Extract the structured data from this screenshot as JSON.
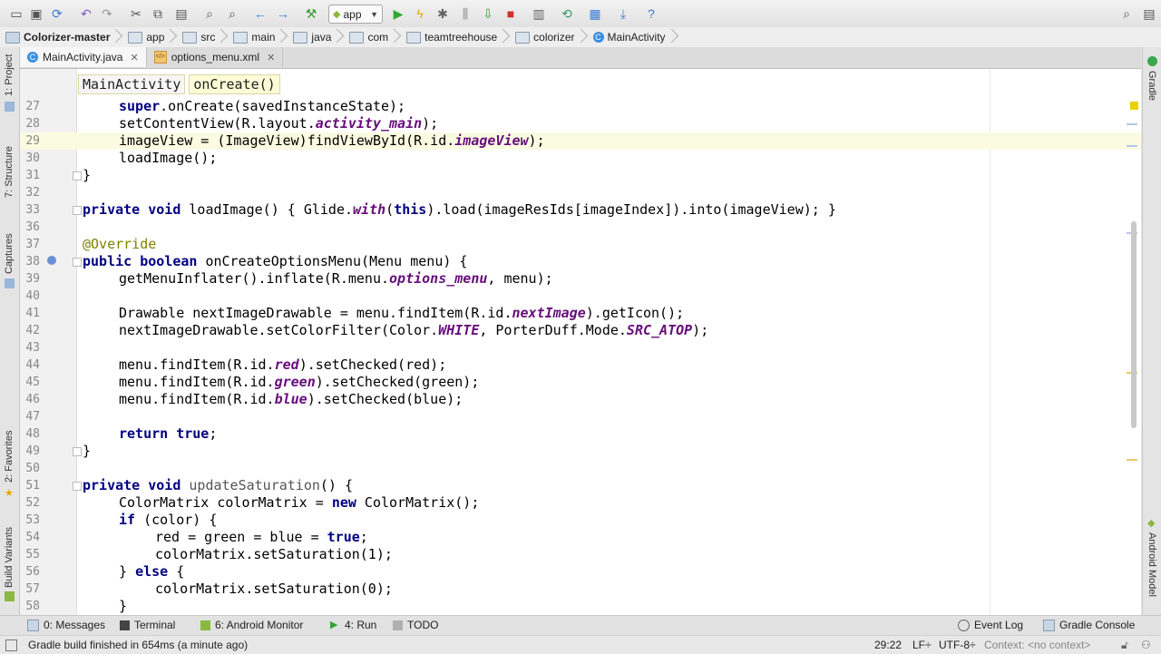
{
  "toolbar": {
    "run_config": "app",
    "icons": [
      "open-icon",
      "save-icon",
      "sync-icon",
      "undo-icon",
      "redo-icon",
      "cut-icon",
      "copy-icon",
      "paste-icon",
      "find-icon",
      "replace-icon",
      "back-icon",
      "forward-icon",
      "make-icon",
      "run-icon",
      "apply-changes-icon",
      "debug-icon",
      "attach-icon",
      "profile-icon",
      "stop-icon",
      "avd-manager-icon",
      "gradle-sync-icon",
      "project-structure-icon",
      "sdk-manager-icon",
      "help-icon",
      "search-icon"
    ]
  },
  "breadcrumb": [
    "Colorizer-master",
    "app",
    "src",
    "main",
    "java",
    "com",
    "teamtreehouse",
    "colorizer",
    "MainActivity"
  ],
  "tabs": [
    {
      "label": "MainActivity.java",
      "active": true
    },
    {
      "label": "options_menu.xml",
      "active": false
    }
  ],
  "method_crumbs": [
    "MainActivity",
    "onCreate()"
  ],
  "left_tools": [
    "1: Project",
    "7: Structure",
    "Captures",
    "2: Favorites",
    "Build Variants"
  ],
  "right_tools": [
    "Gradle",
    "Android Model"
  ],
  "code_lines": [
    {
      "n": "27",
      "t": "super.onCreate(savedInstanceState);"
    },
    {
      "n": "28",
      "t": "setContentView(R.layout.activity_main);"
    },
    {
      "n": "29",
      "t": "imageView = (ImageView)findViewById(R.id.imageView);"
    },
    {
      "n": "30",
      "t": "loadImage();"
    },
    {
      "n": "31",
      "t": "}"
    },
    {
      "n": "32",
      "t": ""
    },
    {
      "n": "33",
      "t": "private void loadImage() { Glide.with(this).load(imageResIds[imageIndex]).into(imageView); }"
    },
    {
      "n": "36",
      "t": ""
    },
    {
      "n": "37",
      "t": "@Override"
    },
    {
      "n": "38",
      "t": "public boolean onCreateOptionsMenu(Menu menu) {"
    },
    {
      "n": "39",
      "t": "getMenuInflater().inflate(R.menu.options_menu, menu);"
    },
    {
      "n": "40",
      "t": ""
    },
    {
      "n": "41",
      "t": "Drawable nextImageDrawable = menu.findItem(R.id.nextImage).getIcon();"
    },
    {
      "n": "42",
      "t": "nextImageDrawable.setColorFilter(Color.WHITE, PorterDuff.Mode.SRC_ATOP);"
    },
    {
      "n": "43",
      "t": ""
    },
    {
      "n": "44",
      "t": "menu.findItem(R.id.red).setChecked(red);"
    },
    {
      "n": "45",
      "t": "menu.findItem(R.id.green).setChecked(green);"
    },
    {
      "n": "46",
      "t": "menu.findItem(R.id.blue).setChecked(blue);"
    },
    {
      "n": "47",
      "t": ""
    },
    {
      "n": "48",
      "t": "return true;"
    },
    {
      "n": "49",
      "t": "}"
    },
    {
      "n": "50",
      "t": ""
    },
    {
      "n": "51",
      "t": "private void updateSaturation() {"
    },
    {
      "n": "52",
      "t": "ColorMatrix colorMatrix = new ColorMatrix();"
    },
    {
      "n": "53",
      "t": "if (color) {"
    },
    {
      "n": "54",
      "t": "red = green = blue = true;"
    },
    {
      "n": "55",
      "t": "colorMatrix.setSaturation(1);"
    },
    {
      "n": "56",
      "t": "} else {"
    },
    {
      "n": "57",
      "t": "colorMatrix.setSaturation(0);"
    },
    {
      "n": "58",
      "t": "}"
    }
  ],
  "bottom_tools": {
    "messages": "0: Messages",
    "terminal": "Terminal",
    "android_monitor": "6: Android Monitor",
    "run": "4: Run",
    "todo": "TODO",
    "event_log": "Event Log",
    "gradle_console": "Gradle Console"
  },
  "status": {
    "message": "Gradle build finished in 654ms (a minute ago)",
    "position": "29:22",
    "line_sep": "LF÷",
    "encoding": "UTF-8÷",
    "context": "Context: <no context>"
  },
  "colors": {
    "keyword": "#000080",
    "field": "#660e7a",
    "annotation": "#808000",
    "current_line": "#fbfbe2"
  }
}
